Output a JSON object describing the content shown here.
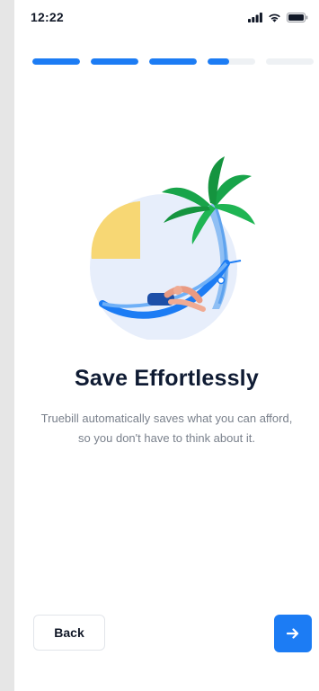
{
  "status_bar": {
    "time": "12:22",
    "icons": [
      "signal-icon",
      "wifi-icon",
      "battery-icon"
    ]
  },
  "progress": {
    "total_steps": 5,
    "completed_steps": 3,
    "current_step_fill": 0.45,
    "color": "#1c7cf4",
    "track_color": "#eef1f4"
  },
  "illustration": {
    "icon": "beach-hammock-illustration"
  },
  "content": {
    "title": "Save Effortlessly",
    "description": "Truebill automatically saves what you can afford, so you don't have to think about it."
  },
  "actions": {
    "back_label": "Back",
    "next_icon": "arrow-right-icon"
  }
}
